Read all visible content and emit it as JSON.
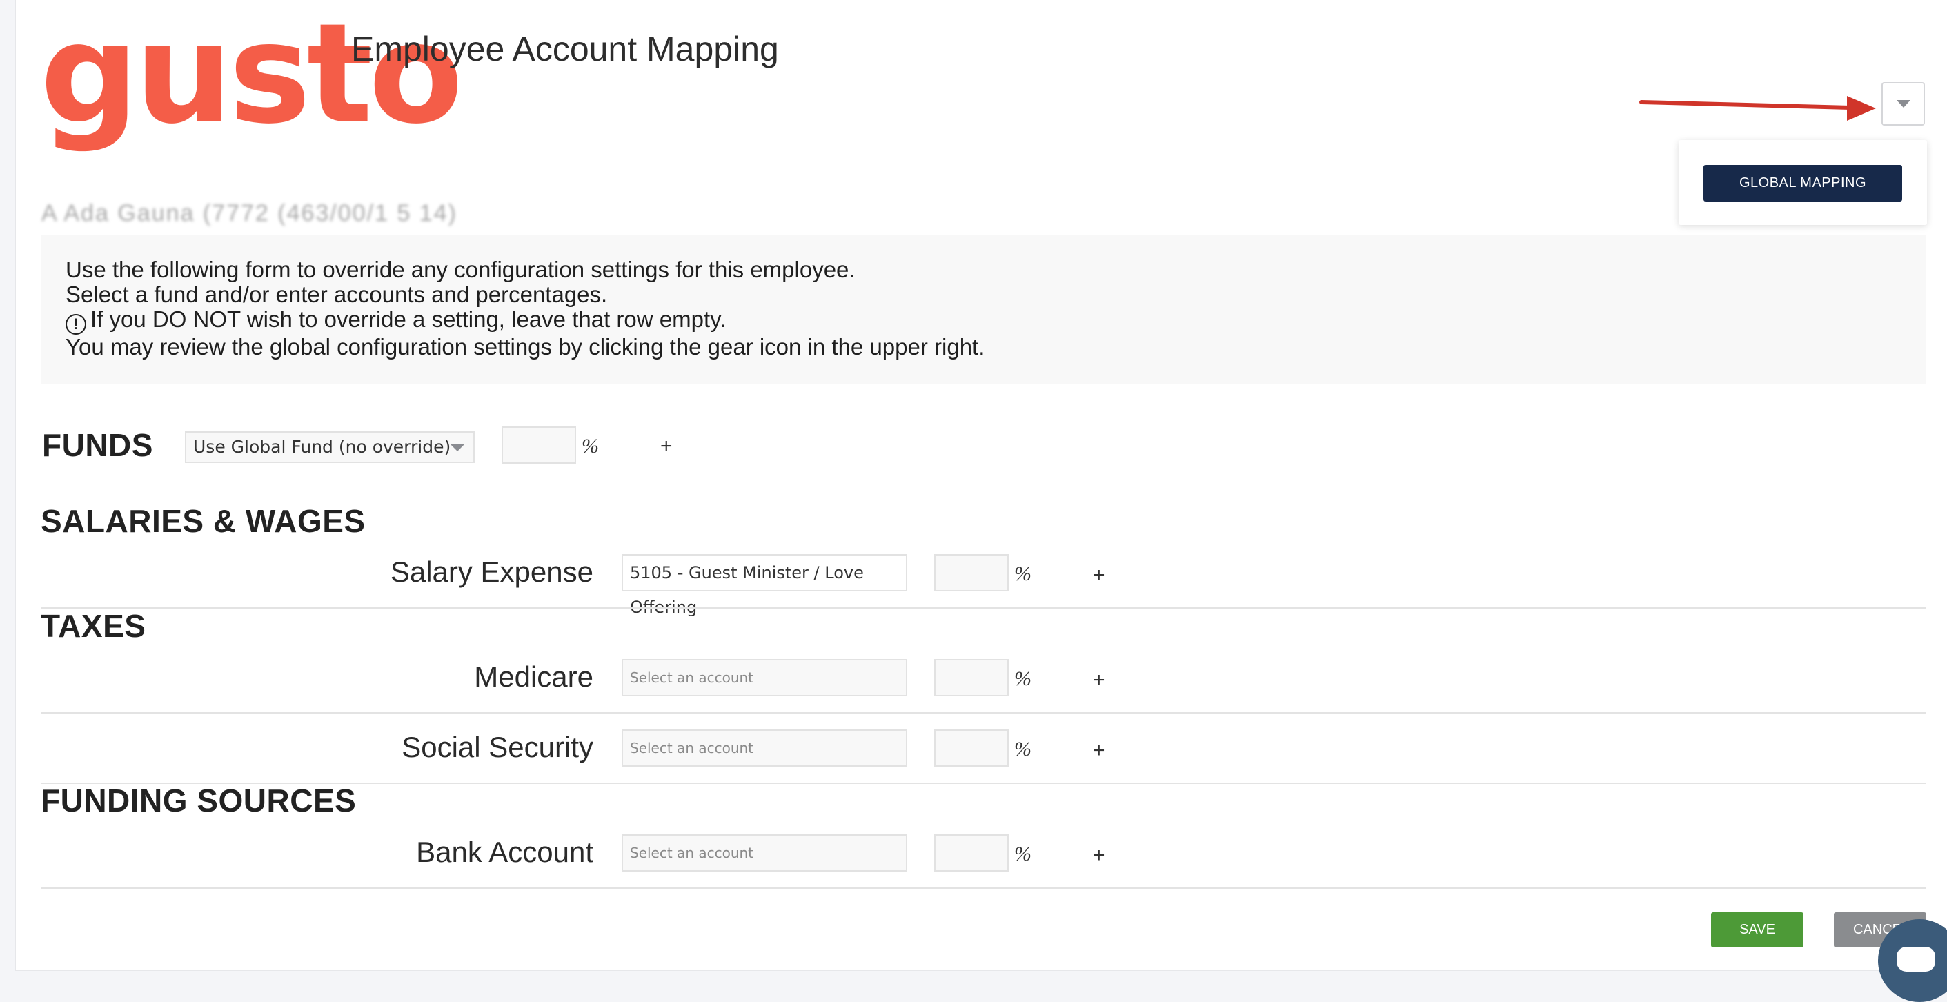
{
  "header": {
    "logo_text": "gusto",
    "title": "Employee Account Mapping"
  },
  "dropdown_menu": {
    "global_mapping_label": "GLOBAL MAPPING"
  },
  "employee": {
    "name_redacted": "A Ada Gauna (7772 (463/00/1 5 14)"
  },
  "info": {
    "line1": "Use the following form to override any configuration settings for this employee.",
    "line2": "Select a fund and/or enter accounts and percentages.",
    "line3_icon": "!",
    "line3": "If you DO NOT wish to override a setting, leave that row empty.",
    "line4": "You may review the global configuration settings by clicking the gear icon in the upper right."
  },
  "funds": {
    "heading": "FUNDS",
    "select_value": "Use Global Fund (no override)",
    "percent_sign": "%",
    "add_label": "+"
  },
  "sections": {
    "salaries": "SALARIES & WAGES",
    "taxes": "TAXES",
    "funding": "FUNDING SOURCES"
  },
  "rows": {
    "salary": {
      "label": "Salary Expense",
      "account_value": "5105 - Guest Minister / Love Offering",
      "percent_sign": "%",
      "add_label": "+"
    },
    "medicare": {
      "label": "Medicare",
      "account_placeholder": "Select an account",
      "percent_sign": "%",
      "add_label": "+"
    },
    "social_security": {
      "label": "Social Security",
      "account_placeholder": "Select an account",
      "percent_sign": "%",
      "add_label": "+"
    },
    "bank": {
      "label": "Bank Account",
      "account_placeholder": "Select an account",
      "percent_sign": "%",
      "add_label": "+"
    }
  },
  "footer": {
    "save_label": "SAVE",
    "cancel_label": "CANCEL"
  },
  "colors": {
    "brand": "#f45d48",
    "navy_button": "#17294a",
    "save_green": "#4d9a37",
    "annotation_arrow": "#d0352a"
  }
}
